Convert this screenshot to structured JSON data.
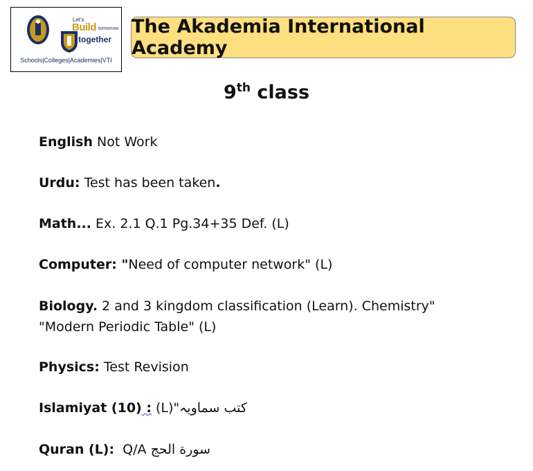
{
  "logo": {
    "lets": "Let's",
    "build": "Build",
    "tomorrow": "tomorrow",
    "together": "together",
    "tagline": "Schools|Colleges|Academies|VTI"
  },
  "banner": {
    "title": "The Akademia International Academy"
  },
  "class_title": {
    "main": "9",
    "sup": "th",
    "rest": " class"
  },
  "entries": [
    {
      "subject": "English",
      "text": " Not Work"
    },
    {
      "subject": "Urdu:",
      "text": " Test has been taken",
      "tail_bold": "."
    },
    {
      "subject": "Math...",
      "text": " Ex. 2.1 Q.1 Pg.34+35 Def. (L)"
    },
    {
      "subject": "Computer: \"",
      "text": "Need of computer network\" (L)"
    },
    {
      "subject": "Biology.",
      "text": " 2 and 3 kingdom classification (Learn). Chemistry\" \"Modern Periodic Table\" (L)"
    },
    {
      "subject": "Physics:",
      "text": " Test Revision"
    },
    {
      "subject": "Islamiyat (10)",
      "subject_tail": " :",
      "text": " (L)\"",
      "urdu": " كتب سماويہ"
    },
    {
      "subject": "Quran (L):",
      "text": "  Q/A ",
      "urdu": "سورة الحج"
    }
  ],
  "colors": {
    "banner_bg": "#ffdf7f",
    "logo_navy": "#1c2e66",
    "logo_gold": "#c79a1c"
  }
}
